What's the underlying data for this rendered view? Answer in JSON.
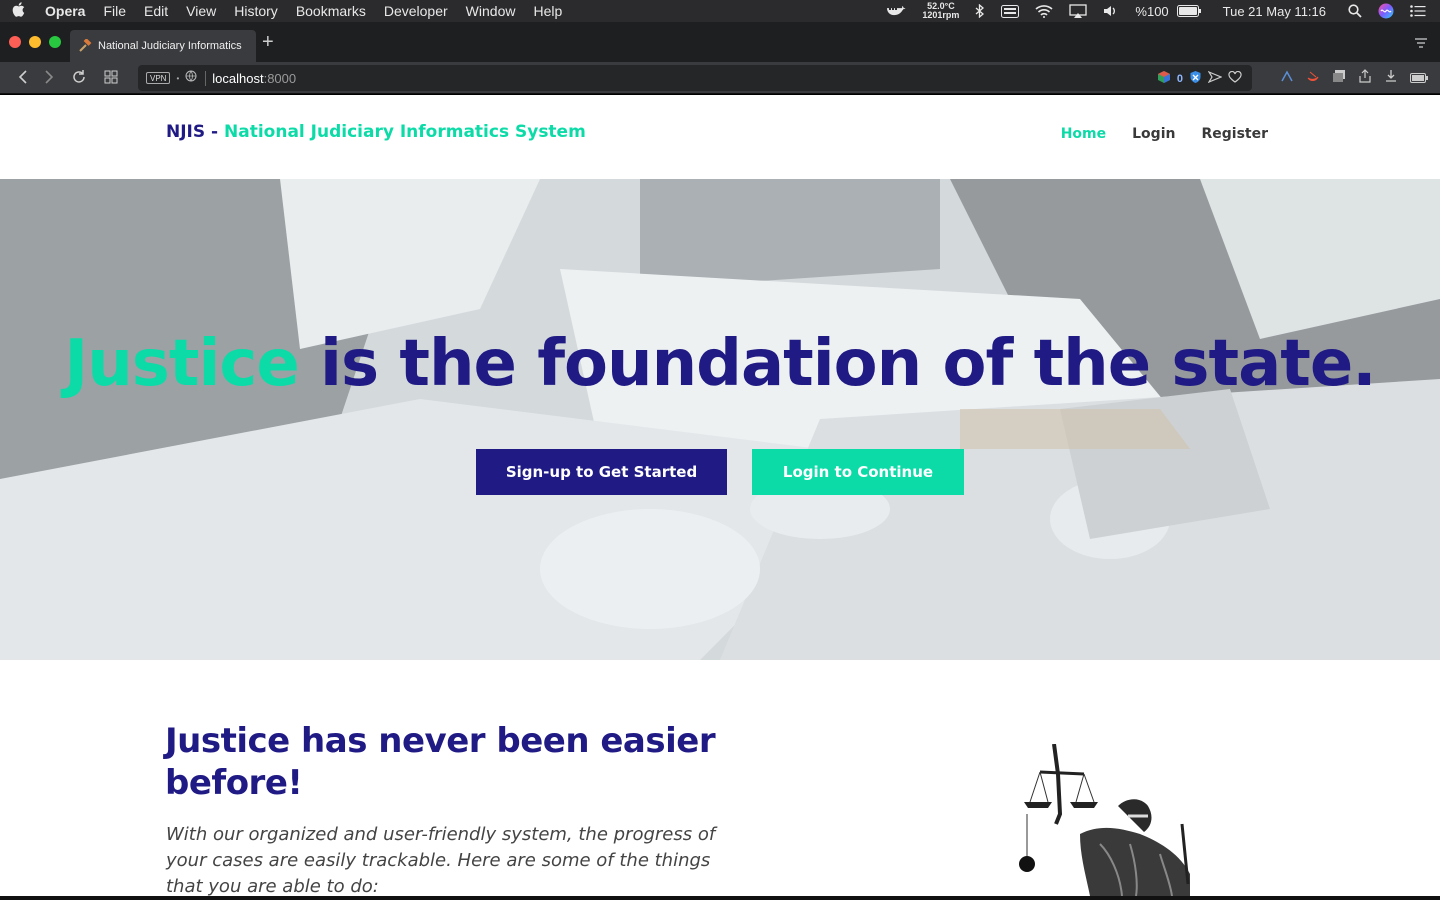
{
  "menubar": {
    "app_name": "Opera",
    "menus": [
      "File",
      "Edit",
      "View",
      "History",
      "Bookmarks",
      "Developer",
      "Window",
      "Help"
    ],
    "temperature": "52.0°C",
    "fan_speed": "1201rpm",
    "battery": "%100",
    "datetime": "Tue 21 May  11:16"
  },
  "browser": {
    "tab_title": "National Judiciary Informatics",
    "address_host": "localhost",
    "address_port": ":8000",
    "vpn_label": "VPN",
    "adblock_count": "0"
  },
  "site": {
    "brand_short": "NJIS - ",
    "brand_long": "National Judiciary Informatics System",
    "nav": {
      "home": "Home",
      "login": "Login",
      "register": "Register"
    },
    "hero": {
      "title_highlight": "Justice",
      "title_rest": " is the foundation of the state.",
      "signup_button": "Sign-up to Get Started",
      "login_button": "Login to Continue"
    },
    "features": {
      "title": "Justice has never been easier before!",
      "text": "With our organized and user-friendly system, the progress of your cases are easily trackable. Here are some of the things that you are able to do:"
    }
  },
  "colors": {
    "primary": "#1f1a84",
    "accent": "#0cdba8"
  },
  "icons": [
    "apple-icon",
    "docker-icon",
    "bluetooth-icon",
    "keyboard-icon",
    "wifi-icon",
    "airplay-icon",
    "volume-icon",
    "battery-icon",
    "search-icon",
    "siri-icon",
    "list-icon",
    "back-icon",
    "forward-icon",
    "reload-icon",
    "grid-icon",
    "globe-icon",
    "shield-icon",
    "send-icon",
    "heart-icon",
    "download-icon",
    "share-icon",
    "scales-of-justice-statue"
  ]
}
